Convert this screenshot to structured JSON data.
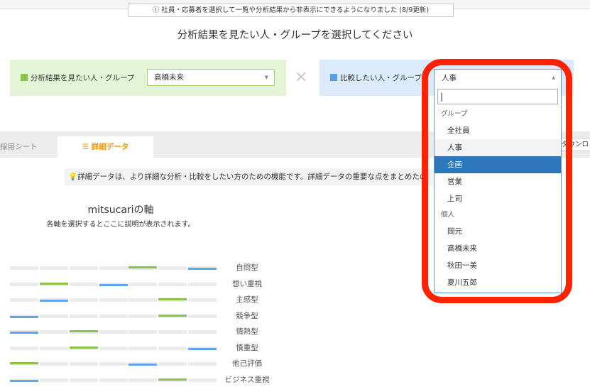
{
  "notice": "社員・応募者を選択して一覧や分析結果から非表示にできるようになりました (8/9更新)",
  "heading": "分析結果を見たい人・グループを選択してください",
  "left_panel": {
    "label": "分析結果を見たい人・グループ",
    "value": "高橋未来",
    "color": "#8bc34a"
  },
  "times": "✕",
  "right_panel": {
    "label": "比較したい人・グループ",
    "color": "#5b9ee8"
  },
  "tabs": [
    {
      "label": "採用シート",
      "active": false
    },
    {
      "label": "詳細データ",
      "active": true,
      "icon": "list-icon"
    }
  ],
  "download_label": "ダウンロ",
  "info": "詳細データは、より詳細な分析・比較をしたい方のための機能です。詳細データの重要な点をまとめたの",
  "axis": {
    "title": "mitsucariの軸",
    "subtitle": "各軸を選択するとここに説明が表示されます。",
    "series_colors": {
      "green": "#8bc34a",
      "blue": "#5ea5ea"
    },
    "rows": [
      {
        "label": "自問型",
        "green": 5,
        "blue": 7
      },
      {
        "label": "想い重視",
        "green": 2,
        "blue": 4
      },
      {
        "label": "主感型",
        "green": 6,
        "blue": 2
      },
      {
        "label": "競争型",
        "green": 6,
        "blue": 1
      },
      {
        "label": "情熱型",
        "green": 3,
        "blue": 1
      },
      {
        "label": "慎重型",
        "green": 3,
        "blue": 7
      },
      {
        "label": "他己評価",
        "green": 1,
        "blue": 5
      },
      {
        "label": "ビジネス重視",
        "green": 6,
        "blue": 1
      }
    ]
  },
  "dropdown": {
    "current": "人事",
    "search_value": "|",
    "groups": [
      {
        "label": "グループ",
        "options": [
          {
            "label": "全社員"
          },
          {
            "label": "人事",
            "state": "hover"
          },
          {
            "label": "企画",
            "state": "selected"
          },
          {
            "label": "営業"
          },
          {
            "label": "上司"
          }
        ]
      },
      {
        "label": "個人",
        "options": [
          {
            "label": "岡元"
          },
          {
            "label": "高橋未来"
          },
          {
            "label": "秋田一美"
          },
          {
            "label": "夏川五郎"
          }
        ]
      }
    ]
  }
}
